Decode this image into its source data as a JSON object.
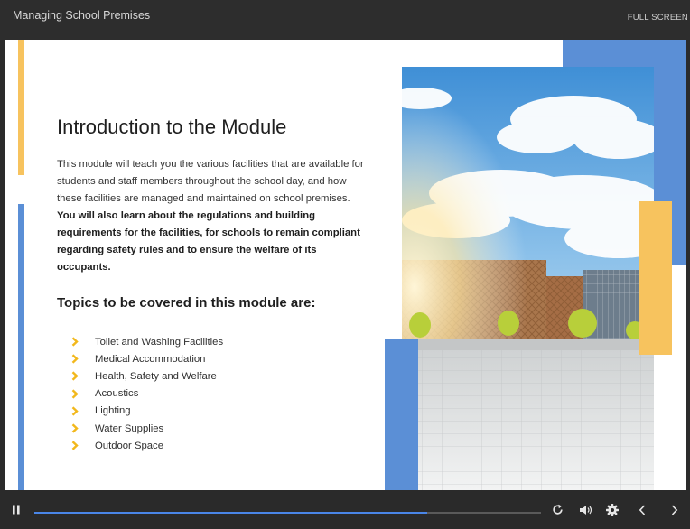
{
  "header": {
    "title": "Managing School Premises",
    "fullscreen_label": "FULL SCREEN"
  },
  "slide": {
    "heading": "Introduction to the Module",
    "intro_plain": "This module will teach you the various facilities that are available for students and staff members throughout the school day, and how these facilities are managed and maintained on school premises. ",
    "intro_bold": "You will also learn about the regulations and building requirements for the facilities, for schools to remain compliant regarding safety rules and to ensure the welfare of its occupants.",
    "topics_heading": "Topics to be covered in this module are:",
    "topics": [
      "Toilet and Washing Facilities",
      "Medical Accommodation",
      "Health, Safety and Welfare",
      "Acoustics",
      "Lighting",
      "Water Supplies",
      "Outdoor Space"
    ]
  },
  "player": {
    "progress": 0.775,
    "icons": [
      "pause-icon",
      "replay-icon",
      "volume-icon",
      "settings-icon",
      "previous-icon",
      "next-icon"
    ]
  },
  "colors": {
    "accent_yellow": "#f7c35e",
    "accent_blue": "#5b8fd6",
    "progress_blue": "#4a86e8",
    "bullet": "#f2b81c"
  }
}
